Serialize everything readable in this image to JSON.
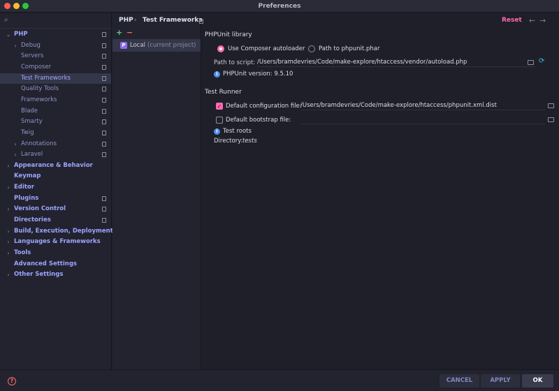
{
  "window": {
    "title": "Preferences"
  },
  "search": {
    "placeholder": "",
    "value": ""
  },
  "sidebar": {
    "items": [
      {
        "label": "PHP",
        "level": 0,
        "expanded": true,
        "project": true
      },
      {
        "label": "Debug",
        "level": 1,
        "expandable": true,
        "project": true
      },
      {
        "label": "Servers",
        "level": 1,
        "project": true
      },
      {
        "label": "Composer",
        "level": 1,
        "project": true
      },
      {
        "label": "Test Frameworks",
        "level": 1,
        "project": true,
        "selected": true
      },
      {
        "label": "Quality Tools",
        "level": 1,
        "project": true
      },
      {
        "label": "Frameworks",
        "level": 1,
        "project": true
      },
      {
        "label": "Blade",
        "level": 1,
        "project": true
      },
      {
        "label": "Smarty",
        "level": 1,
        "project": true
      },
      {
        "label": "Twig",
        "level": 1,
        "project": true
      },
      {
        "label": "Annotations",
        "level": 1,
        "expandable": true,
        "project": true
      },
      {
        "label": "Laravel",
        "level": 1,
        "expandable": true,
        "project": true
      },
      {
        "label": "Appearance & Behavior",
        "level": 0,
        "expandable": true
      },
      {
        "label": "Keymap",
        "level": 0
      },
      {
        "label": "Editor",
        "level": 0,
        "expandable": true
      },
      {
        "label": "Plugins",
        "level": 0,
        "project": true
      },
      {
        "label": "Version Control",
        "level": 0,
        "expandable": true,
        "project": true
      },
      {
        "label": "Directories",
        "level": 0,
        "project": true
      },
      {
        "label": "Build, Execution, Deployment",
        "level": 0,
        "expandable": true
      },
      {
        "label": "Languages & Frameworks",
        "level": 0,
        "expandable": true
      },
      {
        "label": "Tools",
        "level": 0,
        "expandable": true
      },
      {
        "label": "Advanced Settings",
        "level": 0
      },
      {
        "label": "Other Settings",
        "level": 0,
        "expandable": true
      }
    ]
  },
  "configs": {
    "add_label": "+",
    "remove_label": "−",
    "item": {
      "name": "Local",
      "hint": "(current project)"
    }
  },
  "header": {
    "crumb_php": "PHP",
    "crumb_sep": "›",
    "crumb_current": "Test Frameworks",
    "reset_label": "Reset",
    "back_icon": "←",
    "forward_icon": "→"
  },
  "phpunit": {
    "section_title": "PHPUnit library",
    "radio_composer": "Use Composer autoloader",
    "radio_phar": "Path to phpunit.phar",
    "path_label": "Path to script:",
    "path_value": "/Users/bramdevries/Code/make-explore/htaccess/vendor/autoload.php",
    "version_text": "PHPUnit version: 9.5.10"
  },
  "runner": {
    "section_title": "Test Runner",
    "default_config_label": "Default configuration file:",
    "default_config_value": "/Users/bramdevries/Code/make-explore/htaccess/phpunit.xml.dist",
    "default_bootstrap_label": "Default bootstrap file:",
    "default_bootstrap_value": "",
    "test_roots_label": "Test roots",
    "directory_label": "Directory:",
    "directory_value": "tests"
  },
  "footer": {
    "help_icon": "?",
    "cancel_label": "CANCEL",
    "apply_label": "APPLY",
    "ok_label": "OK"
  },
  "colors": {
    "accent": "#ff6ab2",
    "selection": "#343649",
    "link": "#9da4ff"
  }
}
